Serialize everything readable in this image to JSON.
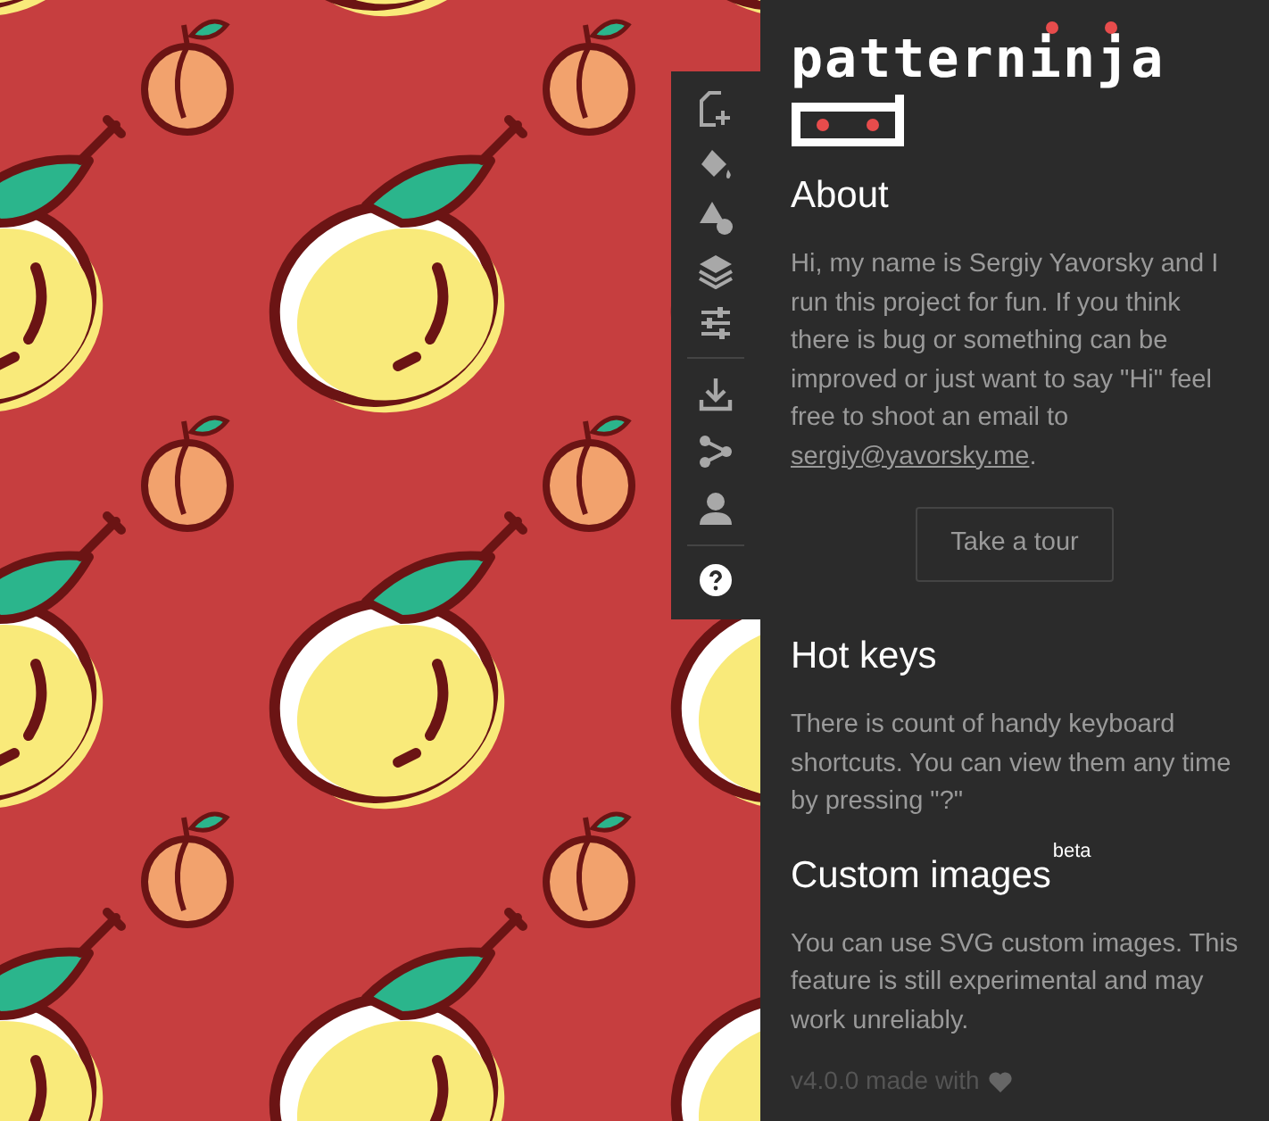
{
  "logo": {
    "text": "patterninja"
  },
  "sections": [
    {
      "kind": "about",
      "title": "About",
      "text_before": "Hi, my name is Sergiy Yavorsky and I run this project for fun. If you think there is bug or something can be improved or just want to say \"Hi\" feel free to shoot an email to ",
      "link": "sergiy@yavorsky.me",
      "text_after": ".",
      "button": "Take a tour"
    },
    {
      "kind": "plain",
      "title": "Hot keys",
      "text": "There is count of handy keyboard shortcuts. You can view them any time by pressing \"?\""
    },
    {
      "kind": "badge",
      "title": "Custom images",
      "badge": "beta",
      "text": "You can use SVG custom images. This feature is still experimental and may work unreliably."
    }
  ],
  "footer": "v4.0.0 made with"
}
